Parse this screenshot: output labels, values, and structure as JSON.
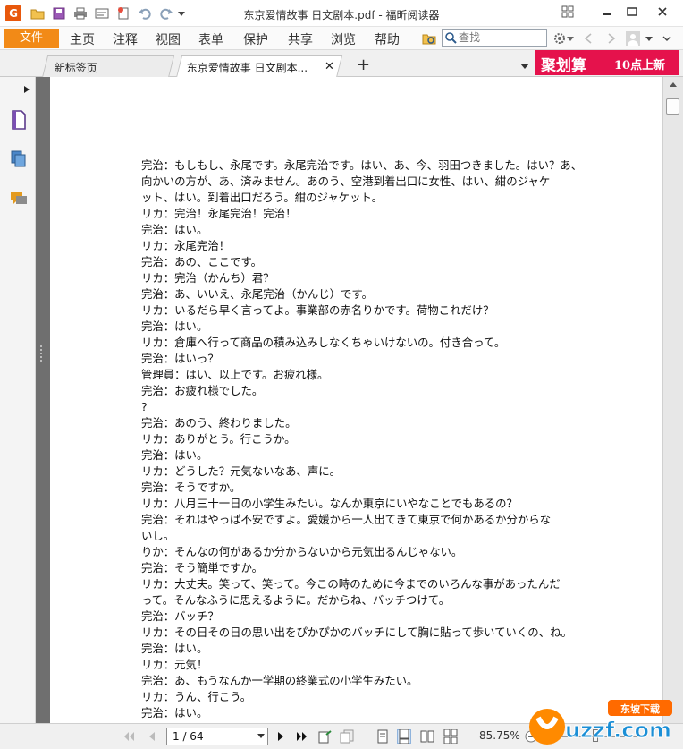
{
  "app": {
    "window_title": "东京爱情故事 日文剧本.pdf - 福昕阅读器",
    "logo_letter": "G",
    "accent_color": "#f28a17"
  },
  "menu": {
    "file": "文件",
    "items": [
      "主页",
      "注释",
      "视图",
      "表单",
      "保护",
      "共享",
      "浏览",
      "帮助"
    ]
  },
  "search": {
    "placeholder": "查找"
  },
  "tabs": [
    {
      "label": "新标签页",
      "active": false
    },
    {
      "label": "东京爱情故事 日文剧本...",
      "active": true
    }
  ],
  "ad": {
    "main": "聚划算",
    "sub": "10点上新",
    "color": "#e5124c"
  },
  "document": {
    "lines": [
      "完治：もしもし、永尾です。永尾完治です。はい、あ、今、羽田つきました。はい？あ、",
      "向かいの方が、あ、済みません。あのう、空港到着出口に女性、はい、紺のジャケ",
      "ット、はい。到着出口だろう。紺のジャケット。",
      "リカ：完治！永尾完治！完治！",
      "完治：はい。",
      "リカ：永尾完治！",
      "完治：あの、ここです。",
      "リカ：完治（かんち）君？",
      "完治：あ、いいえ、永尾完治（かんじ）です。",
      "リカ：いるだら早く言ってよ。事業部の赤名りかです。荷物これだけ？",
      "完治：はい。",
      "リカ：倉庫へ行って商品の積み込みしなくちゃいけないの。付き合って。",
      "完治：はいっ？",
      "管理員：はい、以上です。お疲れ様。",
      "完治：お疲れ様でした。",
      "?",
      "完治：あのう、終わりました。",
      "リカ：ありがとう。行こうか。",
      "完治：はい。",
      "リカ：どうした？元気ないなあ、声に。",
      "完治：そうですか。",
      "リカ：八月三十一日の小学生みたい。なんか東京にいやなことでもあるの？",
      "完治：それはやっぱ不安ですよ。愛媛から一人出てきて東京で何かあるか分からな",
      "いし。",
      "りか：そんなの何があるか分からないから元気出るんじゃない。",
      "完治：そう簡単ですか。",
      "リカ：大丈夫。笑って、笑って。今この時のために今までのいろんな事があったんだ",
      "って。そんなふうに思えるように。だからね、バッチつけて。",
      "完治：バッチ？",
      "リカ：その日その日の思い出をぴかぴかのバッチにして胸に貼って歩いていくの、ね。",
      "完治：はい。",
      "リカ：元気！",
      "完治：あ、もうなんか一学期の終業式の小学生みたい。",
      "リカ：うん、行こう。",
      "完治：はい。",
      "?"
    ]
  },
  "status": {
    "page_display": "1 / 64",
    "zoom": "85.75%"
  },
  "watermark": {
    "text": "uzzf.com",
    "badge": "东坡下载"
  }
}
